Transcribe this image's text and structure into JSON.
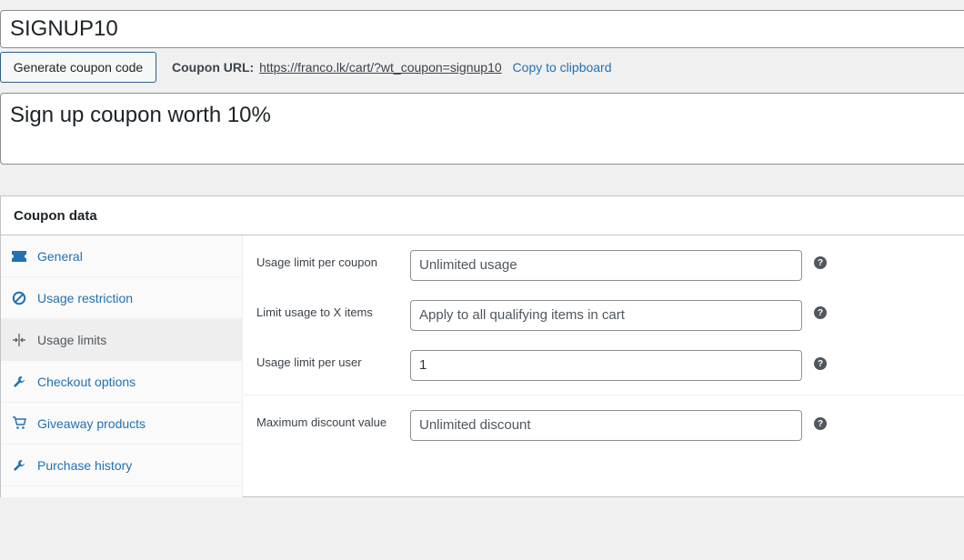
{
  "coupon": {
    "code": "SIGNUP10",
    "description": "Sign up coupon worth 10%"
  },
  "actions": {
    "generate_label": "Generate coupon code",
    "coupon_url_label": "Coupon URL:",
    "coupon_url": "https://franco.lk/cart/?wt_coupon=signup10",
    "copy_label": "Copy to clipboard"
  },
  "panel": {
    "title": "Coupon data",
    "tabs": [
      {
        "label": "General",
        "icon": "ticket-icon"
      },
      {
        "label": "Usage restriction",
        "icon": "ban-icon"
      },
      {
        "label": "Usage limits",
        "icon": "limits-icon",
        "active": true
      },
      {
        "label": "Checkout options",
        "icon": "wrench-icon"
      },
      {
        "label": "Giveaway products",
        "icon": "cart-icon"
      },
      {
        "label": "Purchase history",
        "icon": "wrench-icon"
      }
    ]
  },
  "usage_limits": {
    "per_coupon": {
      "label": "Usage limit per coupon",
      "placeholder": "Unlimited usage",
      "value": ""
    },
    "x_items": {
      "label": "Limit usage to X items",
      "placeholder": "Apply to all qualifying items in cart",
      "value": ""
    },
    "per_user": {
      "label": "Usage limit per user",
      "placeholder": "",
      "value": "1"
    },
    "max_discount": {
      "label": "Maximum discount value",
      "placeholder": "Unlimited discount",
      "value": ""
    },
    "help_glyph": "?"
  },
  "colors": {
    "accent": "#2271b1",
    "background": "#f0f0f1",
    "border": "#8c8f94"
  }
}
